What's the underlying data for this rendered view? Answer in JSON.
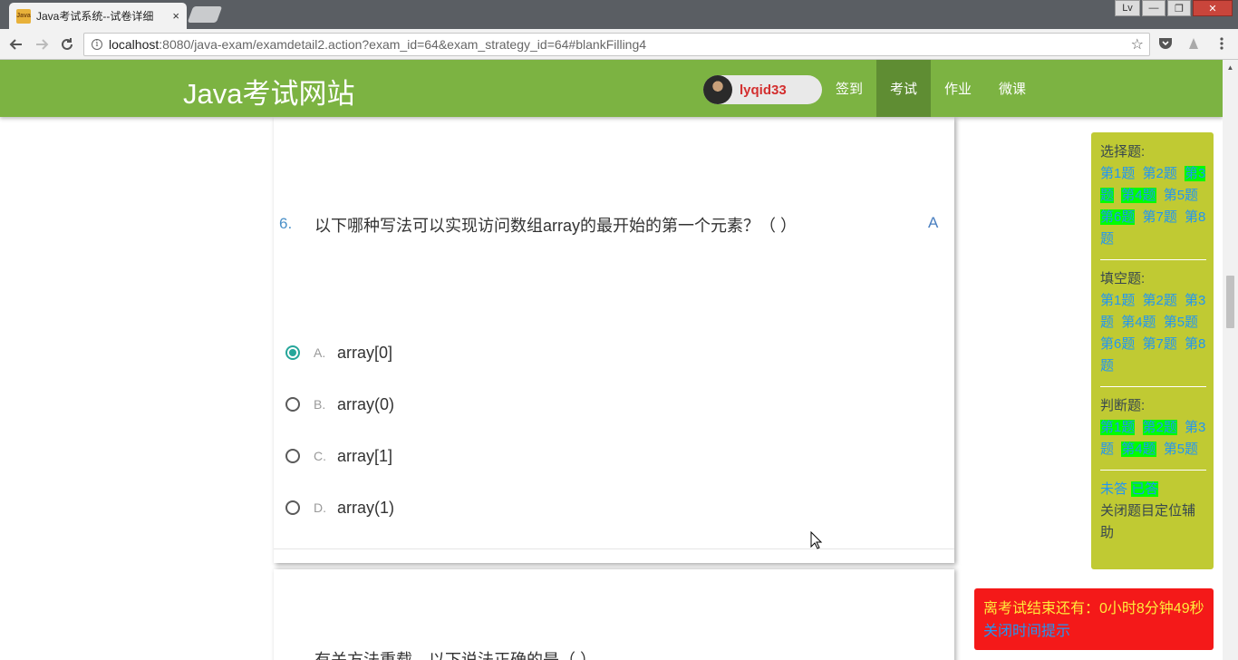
{
  "browser": {
    "tab_title": "Java考试系统--试卷详细",
    "tab_close": "×",
    "favicon_text": "Java",
    "window_buttons": {
      "lv": "Lv",
      "minimize": "—",
      "maximize": "❐",
      "close": "✕"
    },
    "url_host": "localhost",
    "url_path": ":8080/java-exam/examdetail2.action?exam_id=64&exam_strategy_id=64#blankFilling4",
    "info_glyph": "i"
  },
  "header": {
    "site_title": "Java考试网站",
    "username": "lyqid33",
    "nav": [
      {
        "label": "签到"
      },
      {
        "label": "考试",
        "active": true
      },
      {
        "label": "作业"
      },
      {
        "label": "微课"
      }
    ]
  },
  "question": {
    "number": "6.",
    "text": "以下哪种写法可以实现访问数组array的最开始的第一个元素？（   ）",
    "answer": "A",
    "options": [
      {
        "letter": "A.",
        "text": "array[0]",
        "checked": true
      },
      {
        "letter": "B.",
        "text": "array(0)",
        "checked": false
      },
      {
        "letter": "C.",
        "text": "array[1]",
        "checked": false
      },
      {
        "letter": "D.",
        "text": "array(1)",
        "checked": false
      }
    ]
  },
  "next_question_partial": "有关方法重载，以下说法正确的是（   ）",
  "sidepanel": {
    "choice_title": "选择题:",
    "choice": [
      {
        "label": "第1题",
        "answered": false
      },
      {
        "label": "第2题",
        "answered": false
      },
      {
        "label": "第3题",
        "answered": true
      },
      {
        "label": "第4题",
        "answered": true
      },
      {
        "label": "第5题",
        "answered": false
      },
      {
        "label": "第6题",
        "answered": true
      },
      {
        "label": "第7题",
        "answered": false
      },
      {
        "label": "第8题",
        "answered": false
      }
    ],
    "blank_title": "填空题:",
    "blank": [
      {
        "label": "第1题",
        "answered": false
      },
      {
        "label": "第2题",
        "answered": false
      },
      {
        "label": "第3题",
        "answered": false
      },
      {
        "label": "第4题",
        "answered": false
      },
      {
        "label": "第5题",
        "answered": false
      },
      {
        "label": "第6题",
        "answered": false
      },
      {
        "label": "第7题",
        "answered": false
      },
      {
        "label": "第8题",
        "answered": false
      }
    ],
    "judge_title": "判断题:",
    "judge": [
      {
        "label": "第1题",
        "answered": true
      },
      {
        "label": "第2题",
        "answered": true
      },
      {
        "label": "第3题",
        "answered": false
      },
      {
        "label": "第4题",
        "answered": true
      },
      {
        "label": "第5题",
        "answered": false
      }
    ],
    "legend_unanswered": "未答",
    "legend_answered": "已答",
    "close_helper": "关闭题目定位辅助"
  },
  "timer": {
    "text": "离考试结束还有：0小时8分钟49秒",
    "close": "关闭时间提示"
  },
  "colors": {
    "header_green": "#7cb342",
    "panel_lime": "#c0ca33",
    "answered_highlight": "#00ff00",
    "timer_red": "#f41919",
    "radio_teal": "#26a69a"
  }
}
